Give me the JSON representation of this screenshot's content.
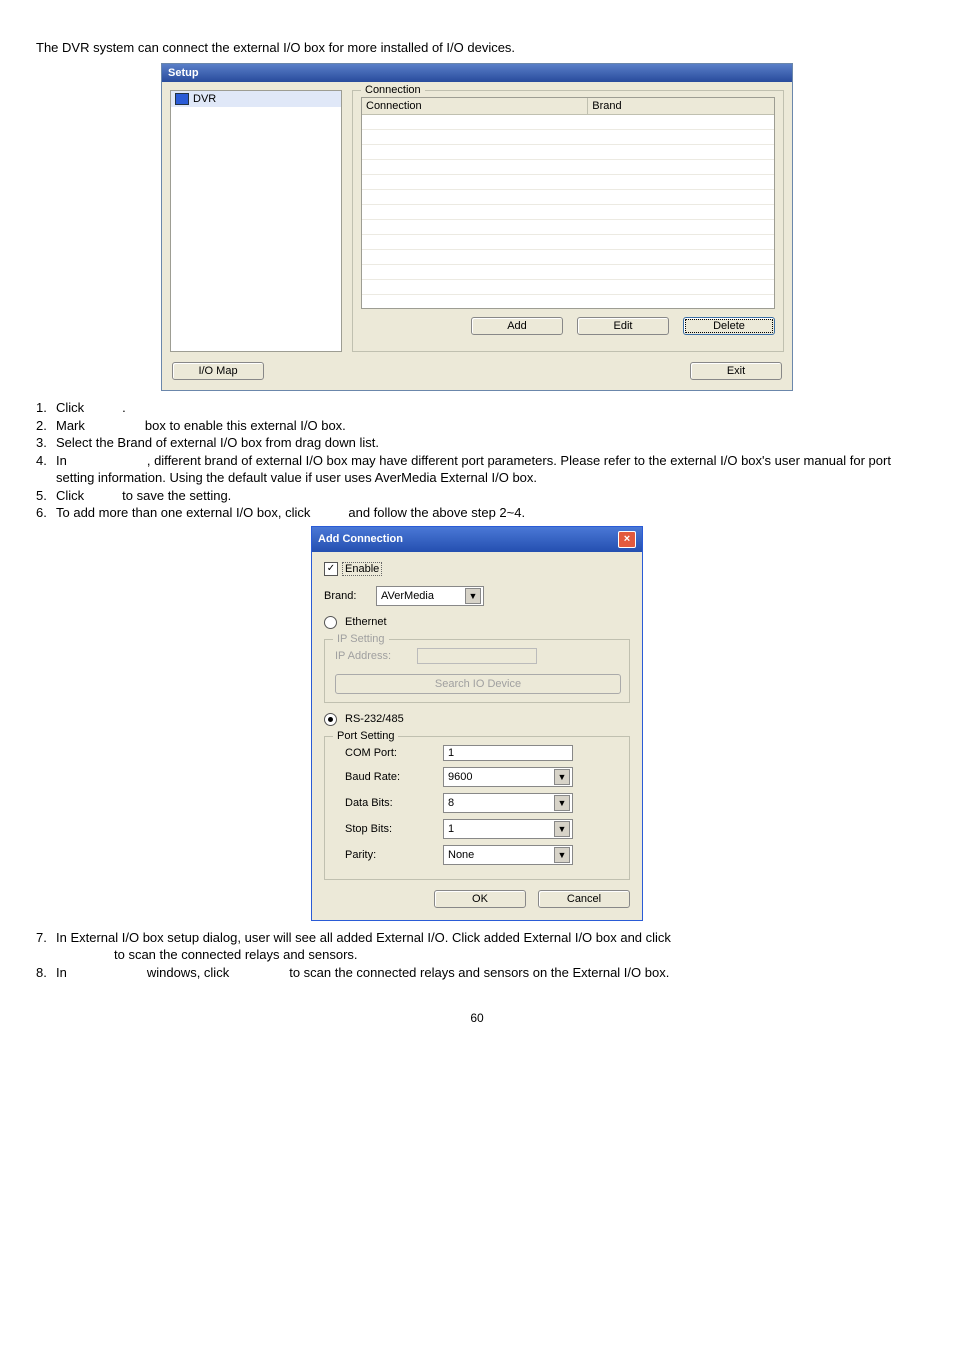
{
  "intro": "The DVR system can connect the external I/O box for more installed of I/O devices.",
  "setup": {
    "title": "Setup",
    "tree_item": "DVR",
    "conn_legend": "Connection",
    "col_connection": "Connection",
    "col_brand": "Brand",
    "btn_add": "Add",
    "btn_edit": "Edit",
    "btn_delete": "Delete",
    "btn_iomap": "I/O Map",
    "btn_exit": "Exit"
  },
  "steps": {
    "s1_pre": "Click",
    "s1_post": ".",
    "s2_a": "Mark",
    "s2_b": "box to enable this external I/O box.",
    "s3": "Select the Brand of external I/O box from drag down list.",
    "s4_a": "In",
    "s4_b": ", different brand of external I/O box may have different port parameters. Please refer to the external I/O box's user manual for port setting information. Using the default value if user uses AverMedia External I/O box.",
    "s5_a": "Click",
    "s5_b": "to save the setting.",
    "s6_a": "To add more than one external I/O box, click",
    "s6_b": "and follow the above step 2~4.",
    "s7_a": "In External I/O box setup dialog, user will see all added External I/O. Click added External I/O box and click",
    "s7_b": "to scan the connected relays and sensors.",
    "s8_a": "In",
    "s8_b": "windows, click",
    "s8_c": "to scan the connected relays and sensors on the External I/O box."
  },
  "add": {
    "title": "Add Connection",
    "enable": "Enable",
    "brand_lbl": "Brand:",
    "brand_val": "AVerMedia",
    "ethernet": "Ethernet",
    "ip_legend": "IP Setting",
    "ip_addr": "IP Address:",
    "search": "Search IO Device",
    "rs": "RS-232/485",
    "port_legend": "Port Setting",
    "com_lbl": "COM Port:",
    "com_val": "1",
    "baud_lbl": "Baud Rate:",
    "baud_val": "9600",
    "databits_lbl": "Data Bits:",
    "databits_val": "8",
    "stopbits_lbl": "Stop Bits:",
    "stopbits_val": "1",
    "parity_lbl": "Parity:",
    "parity_val": "None",
    "ok": "OK",
    "cancel": "Cancel"
  },
  "page_number": "60"
}
